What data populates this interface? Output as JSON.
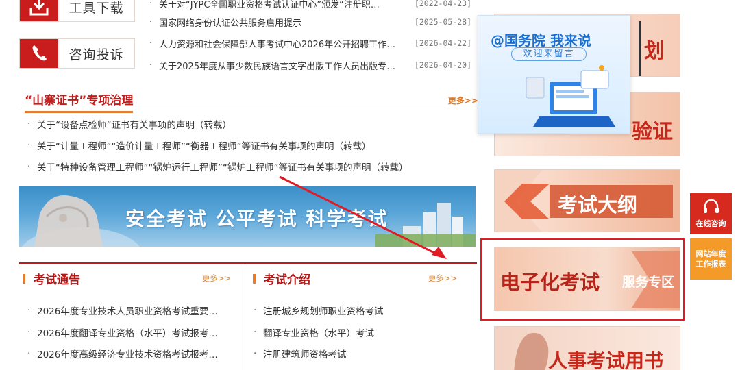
{
  "tools": [
    {
      "label": "工具下载",
      "icon": "download-icon"
    },
    {
      "label": "咨询投诉",
      "icon": "phone-icon"
    }
  ],
  "news": [
    {
      "title": "关于对“JYPC全国职业资格考试认证中心”颁发“注册职…",
      "date": "[2022-04-23]"
    },
    {
      "title": "国家网络身份认证公共服务启用提示",
      "date": "[2025-05-28]"
    },
    {
      "title": "人力资源和社会保障部人事考试中心2026年公开招聘工作…",
      "date": "[2026-04-22]"
    },
    {
      "title": "关于2025年度从事少数民族语言文字出版工作人员出版专…",
      "date": "[2026-04-20]"
    }
  ],
  "fake_cert": {
    "title": "“山寨证书”专项治理",
    "more": "更多>>",
    "items": [
      "关于“设备点检师”证书有关事项的声明（转载）",
      "关于“计量工程师”“造价计量工程师”“衡器工程师”等证书有关事项的声明（转载）",
      "关于“特种设备管理工程师”“锅炉运行工程师”“锅炉工程师”等证书有关事项的声明（转载）"
    ]
  },
  "banner": {
    "slogan": "安全考试  公平考试  科学考试"
  },
  "exam_notice": {
    "title": "考试通告",
    "more": "更多>>",
    "items": [
      "2026年度专业技术人员职业资格考试重要…",
      "2026年度翻译专业资格（水平）考试报考…",
      "2026年度高级经济专业技术资格考试报考…"
    ]
  },
  "exam_intro": {
    "title": "考试介绍",
    "more": "更多>>",
    "items": [
      "注册城乡规划师职业资格考试",
      "翻译专业资格（水平）考试",
      "注册建筑师资格考试"
    ]
  },
  "right_banners": {
    "plan": "划",
    "verify": "验证",
    "syllabus": "考试大纲",
    "eexam_main": "电子化考试",
    "eexam_sub": "服务专区",
    "books": "人事考试用书"
  },
  "popup": {
    "title": "@国务院 我来说",
    "subtitle": "欢迎来留言"
  },
  "float": {
    "consult": "在线咨询",
    "report": "网站年度\n工作报表"
  },
  "colors": {
    "brand_red": "#c41a1a",
    "accent_orange": "#e47b2e",
    "highlight_red": "#e01b24"
  }
}
